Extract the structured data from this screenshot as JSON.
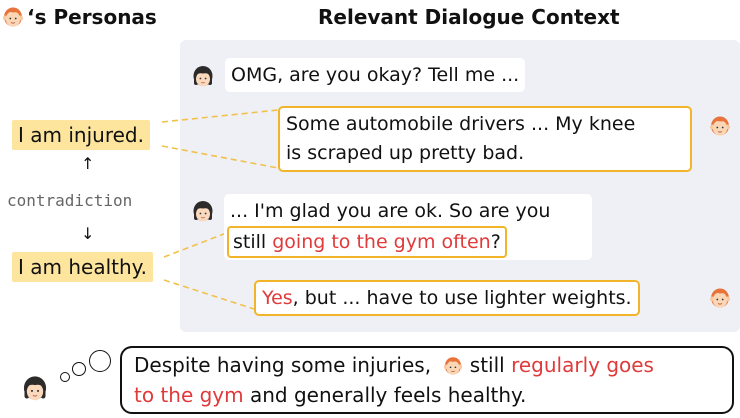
{
  "header": {
    "personas_title": "‘s Personas",
    "context_title": "Relevant Dialogue Context"
  },
  "personas": {
    "injured": "I am injured.",
    "healthy": "I am healthy.",
    "relation": "contradiction"
  },
  "dialogue": [
    {
      "speaker": "girl",
      "text": "OMG, are you okay? Tell me ..."
    },
    {
      "speaker": "boy",
      "line1": "Some automobile drivers ... My knee",
      "line2": "is scraped up pretty bad."
    },
    {
      "speaker": "girl",
      "line1": "... I'm glad you are ok. So are you",
      "line2_pre": "still ",
      "line2_red": "going to the gym often",
      "line2_post": "?"
    },
    {
      "speaker": "boy",
      "red": "Yes",
      "text": ", but ... have to use lighter weights."
    }
  ],
  "summary": {
    "part1": "Despite having some injuries,",
    "part2": " still ",
    "red1": "regularly goes",
    "red2": "to the gym",
    "part3": " and generally feels healthy."
  },
  "colors": {
    "highlight_border": "#f2b52a",
    "persona_fill": "#fde59d",
    "emphasis_red": "#e03a3a",
    "panel_bg": "#eef0f6"
  },
  "icons": [
    "boy-face-icon",
    "girl-face-icon",
    "thought-bubble-icon",
    "arrow-up-icon",
    "arrow-down-icon"
  ]
}
